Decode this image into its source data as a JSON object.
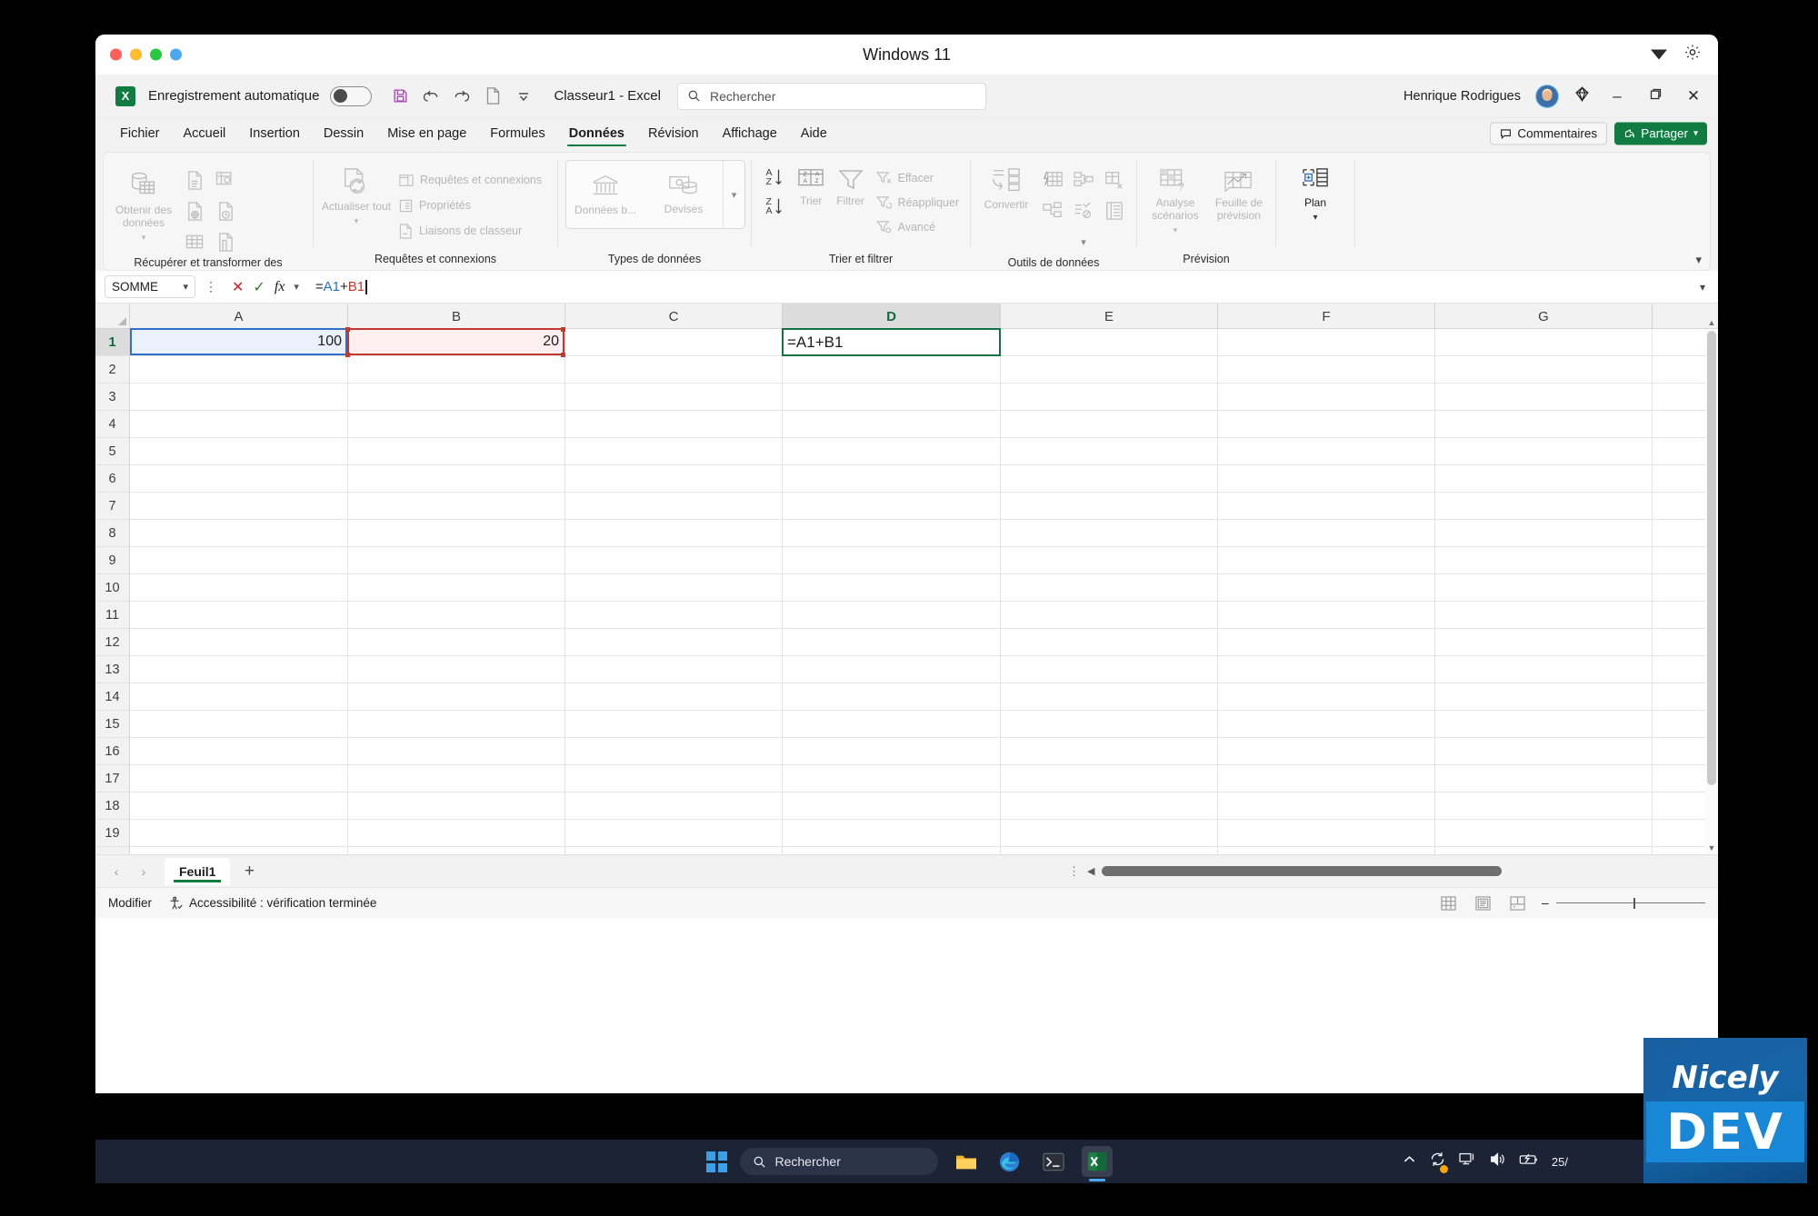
{
  "window": {
    "title": "Windows 11"
  },
  "quick_access": {
    "app_icon": "excel-icon",
    "autosave_label": "Enregistrement automatique",
    "autosave_state": "off",
    "save_icon": "save-icon",
    "undo_icon": "undo-icon",
    "redo_icon": "redo-icon",
    "new_icon": "new-document-icon",
    "customize_icon": "chevron-down-icon",
    "document_title": "Classeur1  -  Excel"
  },
  "search": {
    "placeholder": "Rechercher",
    "icon": "search-icon"
  },
  "account": {
    "user_name": "Henrique Rodrigues",
    "avatar": "user-avatar",
    "diamond_icon": "diamond-icon",
    "minimize": "–",
    "restore": "❐",
    "close": "✕"
  },
  "ribbon": {
    "tabs": [
      {
        "label": "Fichier",
        "active": false
      },
      {
        "label": "Accueil",
        "active": false
      },
      {
        "label": "Insertion",
        "active": false
      },
      {
        "label": "Dessin",
        "active": false
      },
      {
        "label": "Mise en page",
        "active": false
      },
      {
        "label": "Formules",
        "active": false
      },
      {
        "label": "Données",
        "active": true
      },
      {
        "label": "Révision",
        "active": false
      },
      {
        "label": "Affichage",
        "active": false
      },
      {
        "label": "Aide",
        "active": false
      }
    ],
    "comments_label": "Commentaires",
    "share_label": "Partager",
    "collapse_icon": "chevron-down-icon",
    "groups": [
      {
        "name": "Récupérer et transformer des données",
        "big_button": "Obtenir des données",
        "small_icons": [
          "from-text-csv-icon",
          "from-web-icon",
          "from-table-range-icon",
          "from-picture-icon",
          "from-recent-sources-icon",
          "existing-connections-icon"
        ]
      },
      {
        "name": "Requêtes et connexions",
        "big_button": "Actualiser tout",
        "items": [
          "Requêtes et connexions",
          "Propriétés",
          "Liaisons de classeur"
        ]
      },
      {
        "name": "Types de données",
        "items": [
          "Données b...",
          "Devises"
        ],
        "more_icon": "chevron-down-icon"
      },
      {
        "name": "Trier et filtrer",
        "sort_asc": "sort-ascending-icon",
        "sort_desc": "sort-descending-icon",
        "sort_label": "Trier",
        "filter_label": "Filtrer",
        "items": [
          "Effacer",
          "Réappliquer",
          "Avancé"
        ]
      },
      {
        "name": "Outils de données",
        "convert_label": "Convertir",
        "icons": [
          "text-to-columns-icon",
          "flash-fill-icon",
          "remove-duplicates-icon",
          "data-validation-icon",
          "consolidate-icon",
          "relationships-icon",
          "manage-data-model-icon"
        ]
      },
      {
        "name": "Prévision",
        "items": [
          "Analyse scénarios",
          "Feuille de prévision"
        ]
      },
      {
        "name": "Plan",
        "big_button": "Plan"
      }
    ]
  },
  "formula_bar": {
    "name_box": "SOMME",
    "name_box_caret": "⌄",
    "kebab_icon": "more-options-icon",
    "cancel_icon": "cancel-icon",
    "enter_icon": "enter-icon",
    "function_icon": "fx",
    "function_caret": "⌄",
    "formula_prefix": "=",
    "formula_ref_a": "A1",
    "formula_operator": "+",
    "formula_ref_b": "B1",
    "formula_full": "=A1+B1",
    "expand_icon": "chevron-down-icon"
  },
  "grid": {
    "columns": [
      "A",
      "B",
      "C",
      "D",
      "E",
      "F",
      "G"
    ],
    "selected_column": "D",
    "rows": [
      "1",
      "2",
      "3",
      "4",
      "5",
      "6",
      "7",
      "8",
      "9",
      "10",
      "11",
      "12",
      "13",
      "14",
      "15",
      "16",
      "17",
      "18",
      "19"
    ],
    "selected_row": "1",
    "cells": {
      "A1": "100",
      "B1": "20",
      "D1": "=A1+B1"
    },
    "reference_colors": {
      "A1": "#2d6fc9",
      "B1": "#c0392b",
      "active": "#137243"
    }
  },
  "sheet_bar": {
    "prev_icon": "chevron-left-icon",
    "next_icon": "chevron-right-icon",
    "tabs": [
      {
        "label": "Feuil1",
        "active": true
      }
    ],
    "add_label": "+",
    "kebab_icon": "more-options-icon",
    "scroll_left_icon": "scroll-left-icon"
  },
  "status_bar": {
    "mode": "Modifier",
    "accessibility_icon": "accessibility-icon",
    "accessibility": "Accessibilité : vérification terminée",
    "views": [
      "normal-view-icon",
      "page-layout-icon",
      "page-break-icon"
    ],
    "zoom_minus": "–",
    "zoom_plus": "+"
  },
  "taskbar": {
    "start_icon": "windows-start-icon",
    "search_placeholder": "Rechercher",
    "search_icon": "search-icon",
    "apps": [
      {
        "name": "file-explorer-icon",
        "active": false
      },
      {
        "name": "edge-browser-icon",
        "active": false
      },
      {
        "name": "terminal-icon",
        "active": false
      },
      {
        "name": "excel-icon",
        "active": true
      }
    ],
    "tray": {
      "chevron_icon": "show-hidden-icons-icon",
      "update_icon": "windows-update-icon",
      "network_icon": "network-icon",
      "volume_icon": "volume-icon",
      "battery_icon": "battery-icon",
      "date": "25/"
    }
  },
  "watermark": {
    "line1": "Nicely",
    "line2": "DEV"
  }
}
